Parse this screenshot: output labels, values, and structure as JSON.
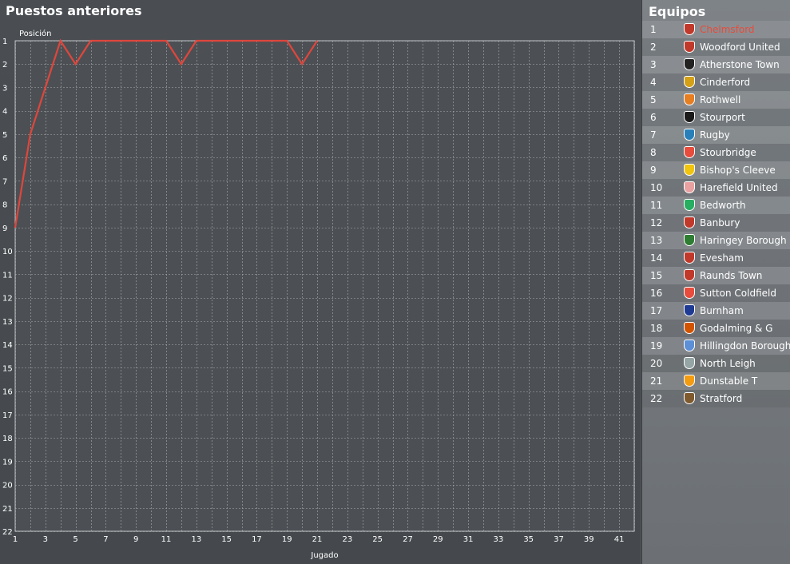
{
  "left_panel": {
    "title": "Puestos anteriores"
  },
  "chart_data": {
    "type": "line",
    "ylabel": "Posición",
    "xlabel": "Jugado",
    "x_ticks": [
      1,
      3,
      5,
      7,
      9,
      11,
      13,
      15,
      17,
      19,
      21,
      23,
      25,
      27,
      29,
      31,
      33,
      35,
      37,
      39,
      41
    ],
    "y_ticks": [
      1,
      2,
      3,
      4,
      5,
      6,
      7,
      8,
      9,
      10,
      11,
      12,
      13,
      14,
      15,
      16,
      17,
      18,
      19,
      20,
      21,
      22
    ],
    "xlim": [
      1,
      42
    ],
    "ylim": [
      1,
      22
    ],
    "y_inverted": true,
    "grid": true,
    "series": [
      {
        "color": "#e0463c",
        "x": [
          1,
          2,
          3,
          4,
          5,
          6,
          7,
          8,
          9,
          10,
          11,
          12,
          13,
          14,
          15,
          16,
          17,
          18,
          19,
          20,
          21
        ],
        "y": [
          9,
          5,
          3,
          1,
          2,
          1,
          1,
          1,
          1,
          1,
          1,
          2,
          1,
          1,
          1,
          1,
          1,
          1,
          1,
          2,
          1
        ]
      }
    ]
  },
  "teams_panel": {
    "title": "Equipos",
    "teams": [
      {
        "pos": "1",
        "name": "Chelmsford",
        "color": "#c0392b",
        "selected": true
      },
      {
        "pos": "2",
        "name": "Woodford United",
        "color": "#c0392b"
      },
      {
        "pos": "3",
        "name": "Atherstone Town",
        "color": "#222222"
      },
      {
        "pos": "4",
        "name": "Cinderford",
        "color": "#d4a017"
      },
      {
        "pos": "5",
        "name": "Rothwell",
        "color": "#e67e22"
      },
      {
        "pos": "6",
        "name": "Stourport",
        "color": "#1a1a1a"
      },
      {
        "pos": "7",
        "name": "Rugby",
        "color": "#2980b9"
      },
      {
        "pos": "8",
        "name": "Stourbridge",
        "color": "#e74c3c"
      },
      {
        "pos": "9",
        "name": "Bishop's Cleeve",
        "color": "#f1c40f"
      },
      {
        "pos": "10",
        "name": "Harefield United",
        "color": "#e8a0a0"
      },
      {
        "pos": "11",
        "name": "Bedworth",
        "color": "#27ae60"
      },
      {
        "pos": "12",
        "name": "Banbury",
        "color": "#c0392b"
      },
      {
        "pos": "13",
        "name": "Haringey Borough",
        "color": "#2e7d32"
      },
      {
        "pos": "14",
        "name": "Evesham",
        "color": "#c0392b"
      },
      {
        "pos": "15",
        "name": "Raunds Town",
        "color": "#c0392b"
      },
      {
        "pos": "16",
        "name": "Sutton Coldfield",
        "color": "#e74c3c"
      },
      {
        "pos": "17",
        "name": "Burnham",
        "color": "#1f3a93"
      },
      {
        "pos": "18",
        "name": "Godalming & G",
        "color": "#d35400"
      },
      {
        "pos": "19",
        "name": "Hillingdon Borough",
        "color": "#5d8fd6"
      },
      {
        "pos": "20",
        "name": "North Leigh",
        "color": "#95a5a6"
      },
      {
        "pos": "21",
        "name": "Dunstable T",
        "color": "#f39c12"
      },
      {
        "pos": "22",
        "name": "Stratford",
        "color": "#7f5a2e"
      }
    ]
  }
}
